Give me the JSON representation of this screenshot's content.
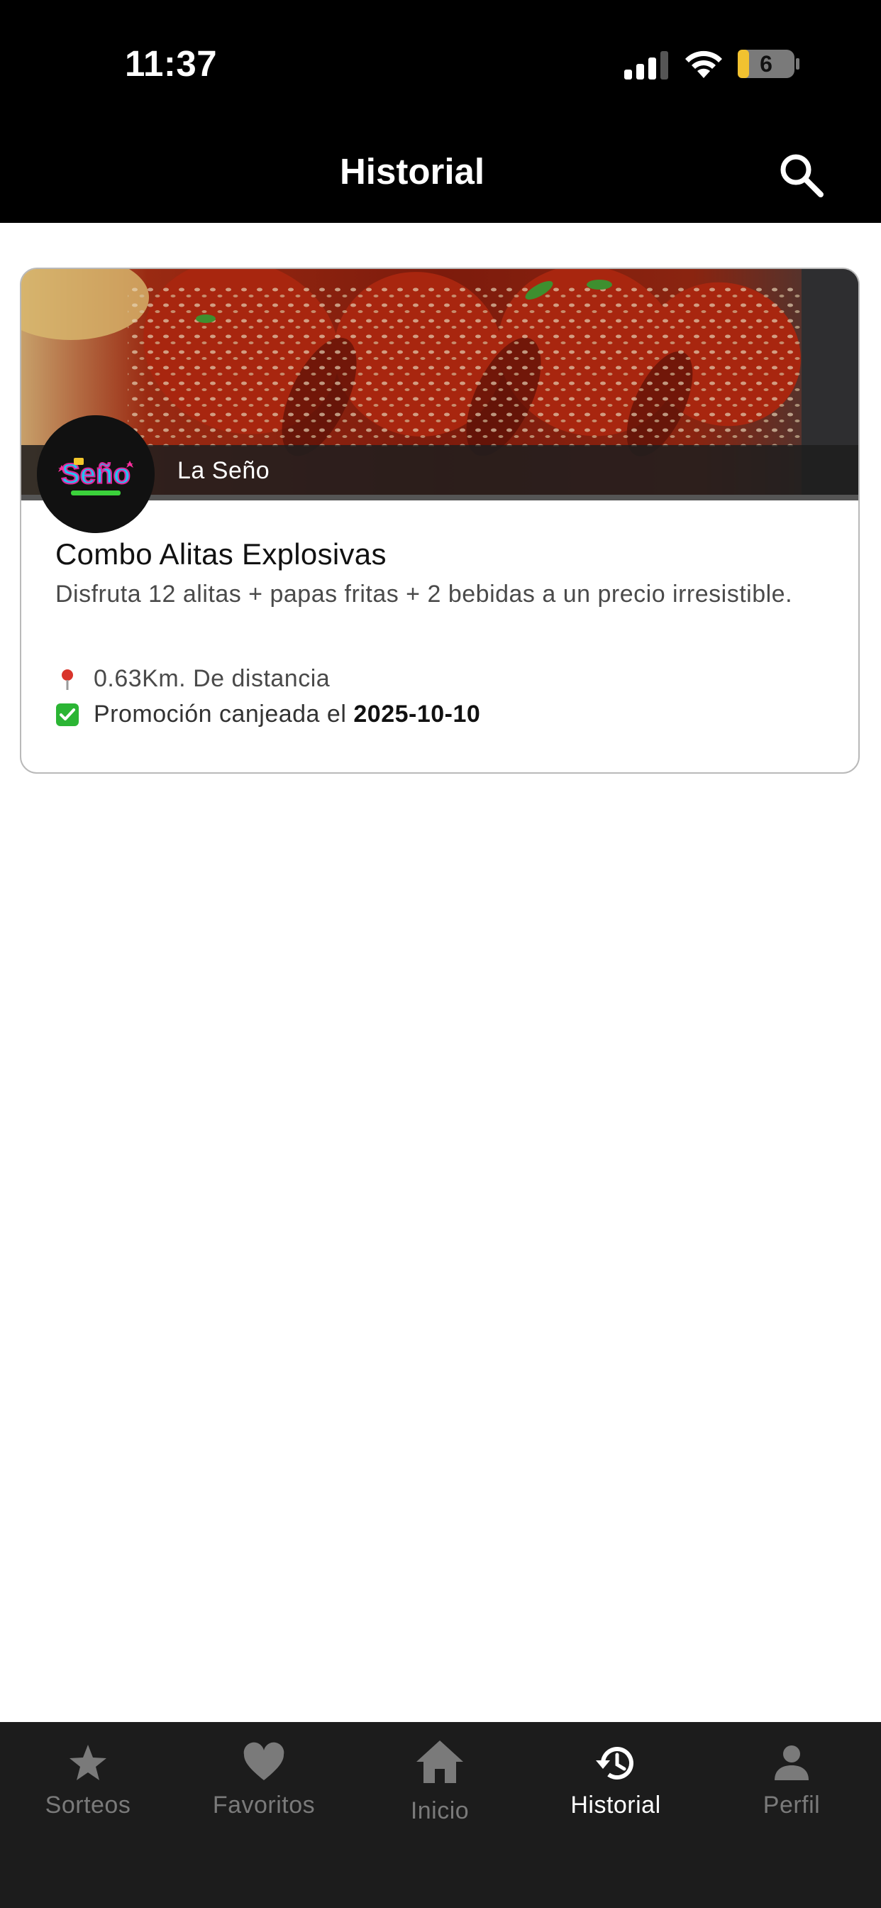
{
  "status_bar": {
    "time": "11:37",
    "battery_level": "6"
  },
  "header": {
    "title": "Historial",
    "search_icon": "search-icon"
  },
  "card": {
    "store_name": "La Seño",
    "logo_text": "Seño",
    "title": "Combo Alitas Explosivas",
    "description": "Disfruta 12 alitas + papas fritas + 2 bebidas a un precio irresistible.",
    "distance": "0.63Km. De distancia",
    "redeemed_label": "Promoción canjeada el",
    "redeemed_date": "2025-10-10"
  },
  "nav": {
    "items": [
      {
        "label": "Sorteos",
        "icon": "star-icon"
      },
      {
        "label": "Favoritos",
        "icon": "heart-icon"
      },
      {
        "label": "Inicio",
        "icon": "home-icon"
      },
      {
        "label": "Historial",
        "icon": "history-icon"
      },
      {
        "label": "Perfil",
        "icon": "person-icon"
      }
    ],
    "active": "Historial"
  },
  "colors": {
    "header_bg": "#000000",
    "nav_bg": "#1c1c1c",
    "nav_active": "#ffffff",
    "nav_inactive": "#7a7a7a"
  }
}
